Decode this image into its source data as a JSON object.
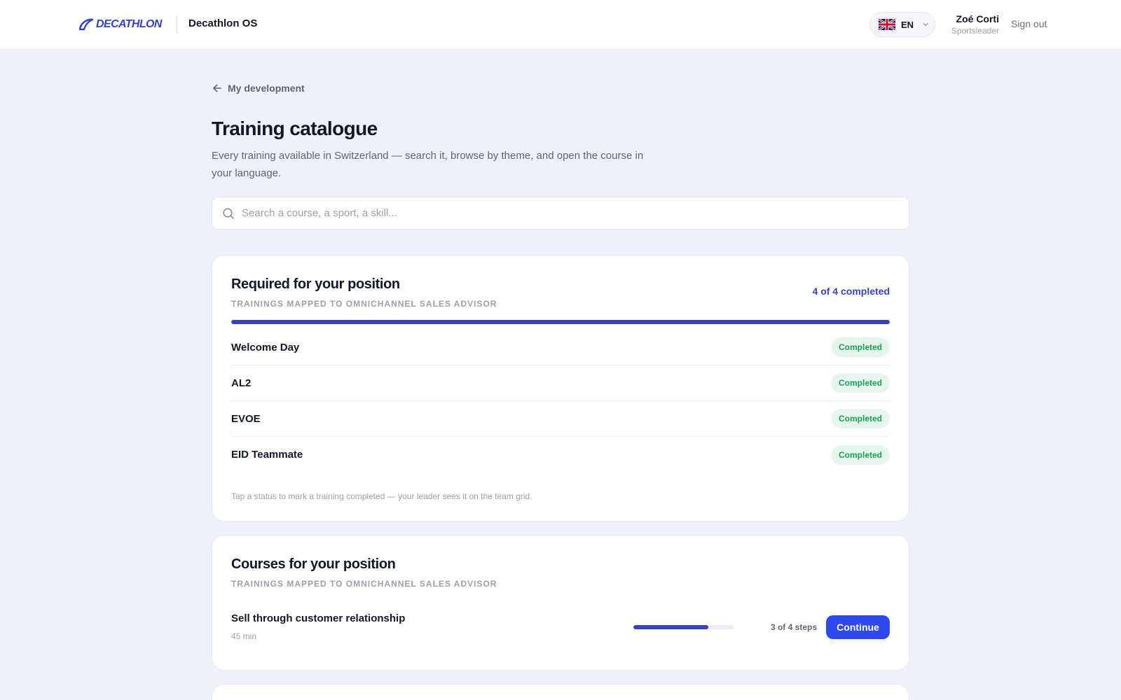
{
  "header": {
    "logo_text": "DECATHLON",
    "app_name": "Decathlon OS",
    "language": {
      "code": "EN",
      "flag": "uk-flag-icon"
    },
    "user": {
      "name": "Zoé Corti",
      "role": "Sportsleader"
    },
    "signout_label": "Sign out"
  },
  "page": {
    "back_label": "My development",
    "title": "Training catalogue",
    "subtitle": "Every training available in Switzerland — search it, browse by theme, and open the course in your language.",
    "search_placeholder": "Search a course, a sport, a skill..."
  },
  "required": {
    "title": "Required for your position",
    "eyebrow": "TRAININGS MAPPED TO OMNICHANNEL SALES ADVISOR",
    "completed_text": "4 of 4 completed",
    "progress_fraction": 1.0,
    "items": [
      {
        "name": "Welcome Day",
        "status": "Completed"
      },
      {
        "name": "AL2",
        "status": "Completed"
      },
      {
        "name": "EVOE",
        "status": "Completed"
      },
      {
        "name": "EID Teammate",
        "status": "Completed"
      }
    ],
    "hint": "Tap a status to mark a training completed — your leader sees it on the team grid."
  },
  "courses": {
    "title": "Courses for your position",
    "eyebrow": "TRAININGS MAPPED TO OMNICHANNEL SALES ADVISOR",
    "items": [
      {
        "name": "Sell through customer relationship",
        "duration": "45 min",
        "progress_fraction": 0.75,
        "steps_text": "3 of 4 steps",
        "action_label": "Continue"
      }
    ]
  },
  "colors": {
    "brand": "#3643ba",
    "accent_button": "#2f48f0",
    "success": "#1f9d55",
    "background": "#eef2f8"
  }
}
